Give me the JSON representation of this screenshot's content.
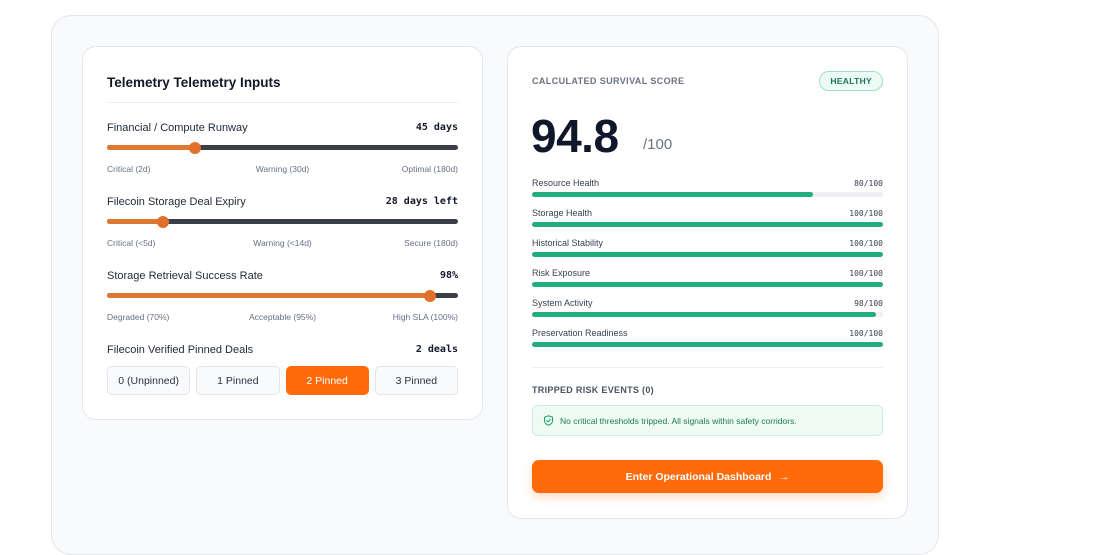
{
  "left": {
    "title": "Telemetry Telemetry Inputs",
    "sliders": [
      {
        "label": "Financial / Compute Runway",
        "value": "45 days",
        "fraction": 0.25,
        "ticks": [
          "Critical (2d)",
          "Warning (30d)",
          "Optimal (180d)"
        ]
      },
      {
        "label": "Filecoin Storage Deal Expiry",
        "value": "28 days left",
        "fraction": 0.16,
        "ticks": [
          "Critical (<5d)",
          "Warning (<14d)",
          "Secure (180d)"
        ]
      },
      {
        "label": "Storage Retrieval Success Rate",
        "value": "98%",
        "fraction": 0.92,
        "ticks": [
          "Degraded (70%)",
          "Acceptable (95%)",
          "High SLA (100%)"
        ]
      }
    ],
    "pinned": {
      "label": "Filecoin Verified Pinned Deals",
      "value": "2 deals",
      "options": [
        "0 (Unpinned)",
        "1 Pinned",
        "2 Pinned",
        "3 Pinned"
      ],
      "selected_index": 2
    }
  },
  "right": {
    "label": "CALCULATED SURVIVAL SCORE",
    "badge": "HEALTHY",
    "score": "94.8",
    "score_max": "/100",
    "metrics": [
      {
        "label": "Resource Health",
        "value": "80/100",
        "fraction": 0.8
      },
      {
        "label": "Storage Health",
        "value": "100/100",
        "fraction": 1.0
      },
      {
        "label": "Historical Stability",
        "value": "100/100",
        "fraction": 1.0
      },
      {
        "label": "Risk Exposure",
        "value": "100/100",
        "fraction": 1.0
      },
      {
        "label": "System Activity",
        "value": "98/100",
        "fraction": 0.98
      },
      {
        "label": "Preservation Readiness",
        "value": "100/100",
        "fraction": 1.0
      }
    ],
    "risk_title": "TRIPPED RISK EVENTS (0)",
    "risk_message": "No critical thresholds tripped. All signals within safety corridors.",
    "cta_label": "Enter Operational Dashboard",
    "cta_arrow": "→"
  },
  "colors": {
    "accent": "#ff6a0a",
    "slider_fill": "#dd7833",
    "metric_fill": "#21ad7d",
    "healthy": "#16785a"
  },
  "icons": {
    "risk_icon": "shield-check-icon",
    "cta_icon": "arrow-right-icon"
  }
}
